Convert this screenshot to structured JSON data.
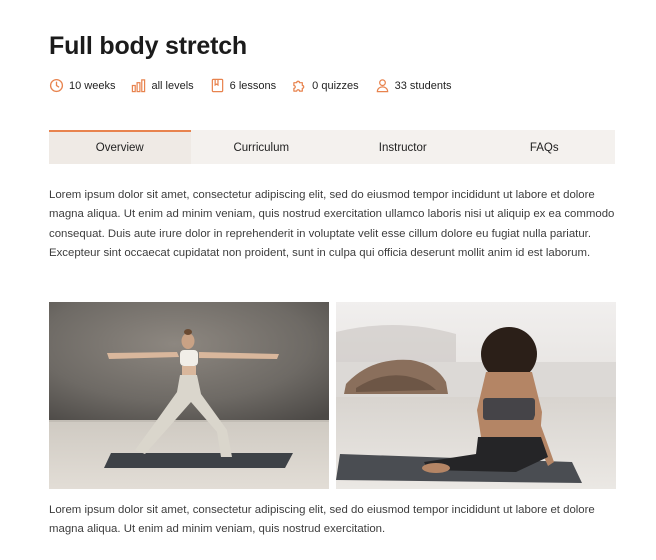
{
  "course": {
    "title": "Full body stretch",
    "meta": {
      "duration": "10 weeks",
      "level": "all levels",
      "lessons": "6 lessons",
      "quizzes": "0 quizzes",
      "students": "33 students"
    }
  },
  "tabs": [
    {
      "label": "Overview",
      "active": true
    },
    {
      "label": "Curriculum",
      "active": false
    },
    {
      "label": "Instructor",
      "active": false
    },
    {
      "label": "FAQs",
      "active": false
    }
  ],
  "content": {
    "paragraph1": "Lorem ipsum dolor sit amet, consectetur adipiscing elit, sed do eiusmod tempor incididunt ut labore et dolore magna aliqua. Ut enim ad minim veniam, quis nostrud exercitation ullamco laboris nisi ut aliquip ex ea commodo consequat. Duis aute irure dolor in reprehenderit in voluptate velit esse cillum dolore eu fugiat nulla pariatur. Excepteur sint occaecat cupidatat non proident, sunt in culpa qui officia deserunt mollit anim id est laborum.",
    "paragraph2": "Lorem ipsum dolor sit amet, consectetur adipiscing elit, sed do eiusmod tempor incididunt ut labore et dolore magna aliqua. Ut enim ad minim veniam, quis nostrud exercitation."
  },
  "icons": {
    "duration": "clock-icon",
    "level": "bar-chart-icon",
    "lessons": "book-icon",
    "quizzes": "puzzle-icon",
    "students": "user-icon"
  },
  "colors": {
    "accent": "#e8834e",
    "tab_bg": "#f4f1ee"
  }
}
